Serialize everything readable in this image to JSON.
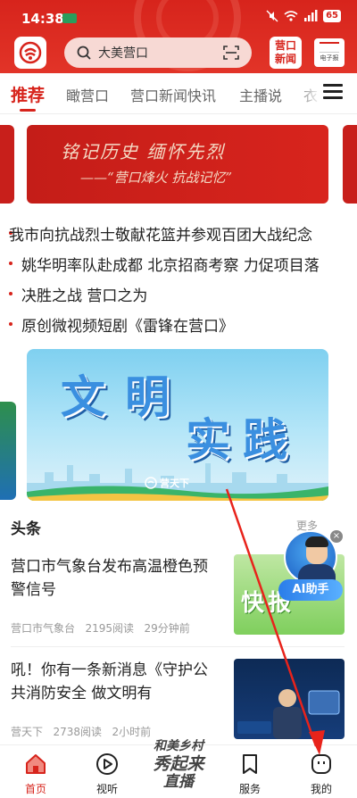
{
  "status_bar": {
    "time": "14:38",
    "battery": "65"
  },
  "header": {
    "search_placeholder": "大美营口",
    "news_badge_line1": "营口",
    "news_badge_line2": "新闻",
    "epaper_label": "电子报"
  },
  "tabs": [
    {
      "label": "推荐",
      "active": true
    },
    {
      "label": "瞰营口",
      "active": false
    },
    {
      "label": "营口新闻快讯",
      "active": false
    },
    {
      "label": "主播说",
      "active": false
    },
    {
      "label": "衣",
      "active": false
    }
  ],
  "banner": {
    "line1": "铭记历史 缅怀先烈",
    "line2": "——“营口烽火 抗战记忆”"
  },
  "ticker": [
    "我市向抗战烈士敬献花篮并参观百团大战纪念",
    "姚华明率队赴成都 北京招商考察 力促项目落",
    "决胜之战 营口之为",
    "原创微视频短剧《雷锋在营口》"
  ],
  "promo": {
    "title1": "文明",
    "title2": "实践",
    "logo_text": "营天下"
  },
  "headlines": {
    "section_title": "头条",
    "more_label": "更多",
    "items": [
      {
        "title": "营口市气象台发布高温橙色预警信号",
        "source": "营口市气象台",
        "reads": "2195阅读",
        "time": "29分钟前",
        "image_text": "快报"
      },
      {
        "title": "吼！你有一条新消息《守护公共消防安全 做文明有",
        "source": "营天下",
        "reads": "2738阅读",
        "time": "2小时前"
      }
    ]
  },
  "ai_assistant": {
    "label": "AI助手"
  },
  "bottom_nav": {
    "items": [
      {
        "label": "首页",
        "icon": "home-icon",
        "active": true
      },
      {
        "label": "视听",
        "icon": "play-icon",
        "active": false
      },
      {
        "label": "服务",
        "icon": "bookmark-icon",
        "active": false
      },
      {
        "label": "我的",
        "icon": "profile-icon",
        "active": false
      }
    ],
    "center_line1": "和美乡村",
    "center_line2": "秀起来",
    "center_line3": "直播"
  },
  "colors": {
    "brand_red": "#d7241c",
    "annotation_arrow": "#e8231b"
  }
}
